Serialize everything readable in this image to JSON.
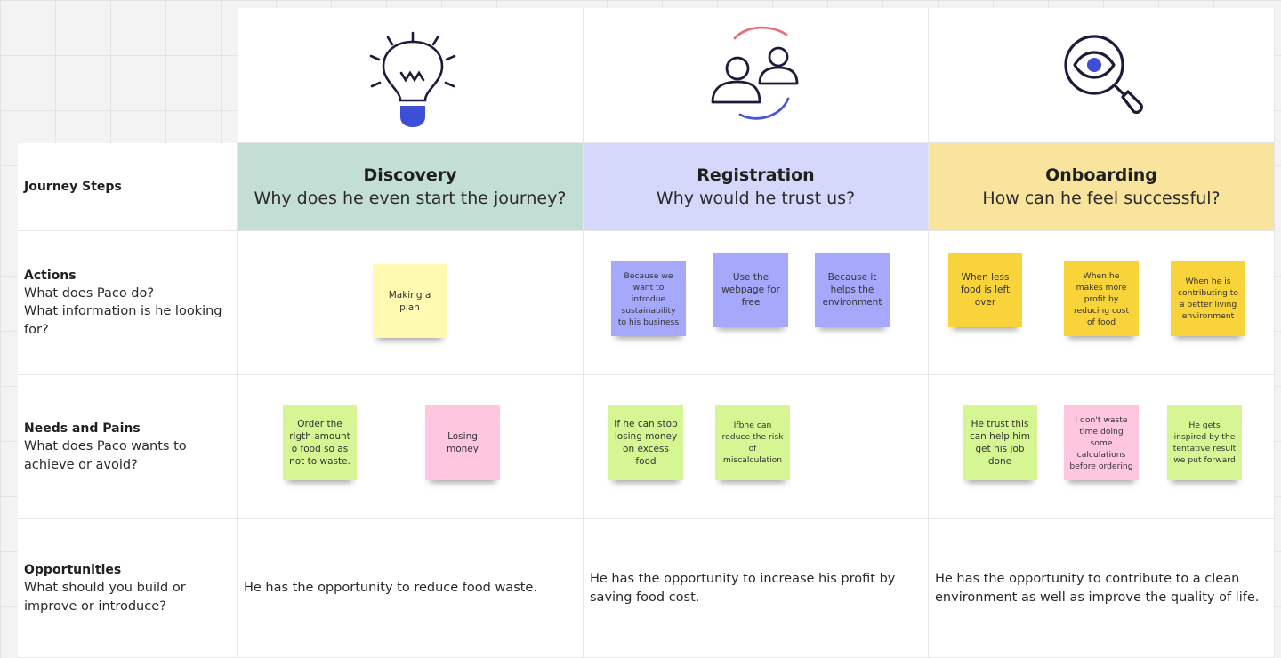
{
  "rows": {
    "journey_steps": "Journey Steps",
    "actions": {
      "title": "Actions",
      "sub": "What does Paco do?\nWhat information is he looking for?"
    },
    "needs": {
      "title": "Needs and Pains",
      "sub": "What does Paco wants to achieve or avoid?"
    },
    "opportunities": {
      "title": "Opportunities",
      "sub": "What should you build or improve or introduce?"
    }
  },
  "stages": [
    {
      "title": "Discovery",
      "subtitle": "Why does he even start the journey?",
      "color": "#c2ded5",
      "icon": "lightbulb-icon",
      "actions": [
        "Making a plan"
      ],
      "needs": [
        "Order the rigth amount o food so as not to waste.",
        "Losing money"
      ],
      "opportunity": "He has the opportunity to reduce food waste."
    },
    {
      "title": "Registration",
      "subtitle": "Why would he trust us?",
      "color": "#d5d8fb",
      "icon": "users-sync-icon",
      "actions": [
        "Because we want to introdue sustainability to his business",
        "Use the webpage for free",
        "Because it helps the environment"
      ],
      "needs": [
        "If he can stop losing money on excess food",
        "Ifbhe can reduce the risk of miscalculation"
      ],
      "opportunity": "He has the opportunity to increase his profit by saving food cost."
    },
    {
      "title": "Onboarding",
      "subtitle": "How can he feel successful?",
      "color": "#f9e49e",
      "icon": "magnifier-eye-icon",
      "actions": [
        "When less food is left over",
        "When he makes more profit by reducing cost of food",
        "When he is contributing to a better living environment"
      ],
      "needs": [
        "He trust this can help him get his job done",
        "I don't waste time doing some calculations before ordering",
        "He gets inspired by the tentative result we put forward"
      ],
      "opportunity": "He has the opportunity to contribute to a clean environment as well as improve the quality of life."
    }
  ]
}
